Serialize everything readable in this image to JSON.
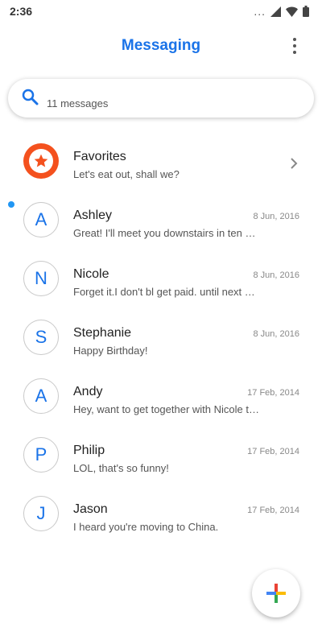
{
  "status_bar": {
    "time": "2:36",
    "dots": "..."
  },
  "app": {
    "title": "Messaging"
  },
  "search": {
    "placeholder": "11 messages"
  },
  "conversations": [
    {
      "name": "Favorites",
      "preview": "Let's eat out, shall we?",
      "date": "",
      "avatar": "star-icon"
    },
    {
      "name": "Ashley",
      "preview": "Great! I'll meet you downstairs in ten minutes.",
      "date": "8 Jun, 2016",
      "initial": "A"
    },
    {
      "name": "Nicole",
      "preview": "Forget it.I don't bl get paid. until next Friday.",
      "date": "8 Jun, 2016",
      "initial": "N"
    },
    {
      "name": "Stephanie",
      "preview": "Happy Birthday!",
      "date": "8 Jun, 2016",
      "initial": "S",
      "unread": true
    },
    {
      "name": "Andy",
      "preview": "Hey, want to get together with Nicole tonight?",
      "date": "17 Feb, 2014",
      "initial": "A"
    },
    {
      "name": "Philip",
      "preview": "LOL, that's so funny!",
      "date": "17 Feb, 2014",
      "initial": "P"
    },
    {
      "name": "Jason",
      "preview": "I heard you're moving to China.",
      "date": "17 Feb, 2014",
      "initial": "J"
    }
  ],
  "colors": {
    "accent": "#1a73e8",
    "favorite": "#f4511e",
    "unread": "#2196f3"
  }
}
